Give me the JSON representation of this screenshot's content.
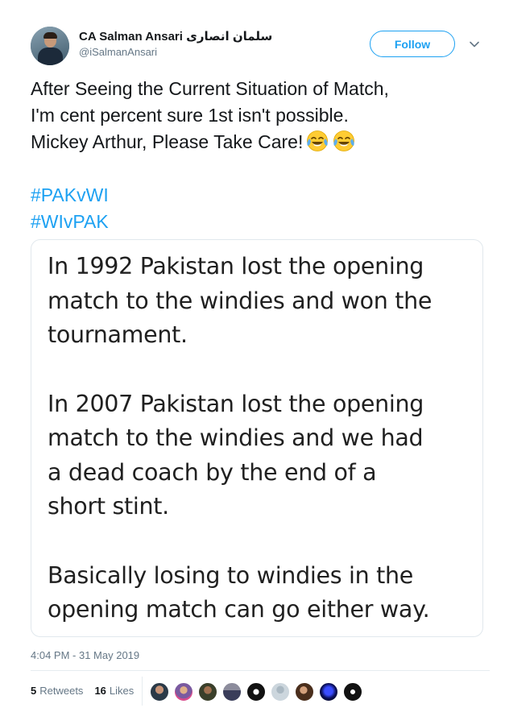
{
  "user": {
    "display_name": "CA Salman Ansari سلمان انصاری",
    "screen_name": "@iSalmanAnsari",
    "avatar_icon": "profile-photo"
  },
  "follow_label": "Follow",
  "tweet": {
    "lines": [
      "After Seeing the Current Situation of Match,",
      "I'm cent percent sure 1st isn't possible.",
      "Mickey Arthur, Please Take Care!"
    ],
    "emoji": "face-with-tears-of-joy-icon",
    "hashtags": [
      "#PAKvWI",
      "#WIvPAK"
    ]
  },
  "media_text": {
    "paragraphs": [
      [
        "In 1992 Pakistan lost the opening",
        "match to the windies and won the",
        "tournament."
      ],
      [
        "In 2007 Pakistan lost the opening",
        "match to the windies and we had",
        "a dead coach by the end of a",
        "short stint."
      ],
      [
        "Basically losing to windies in the",
        "opening match can go either way."
      ]
    ]
  },
  "timestamp": "4:04 PM - 31 May 2019",
  "stats": {
    "retweets_count": "5",
    "retweets_label": "Retweets",
    "likes_count": "16",
    "likes_label": "Likes"
  },
  "colors": {
    "accent": "#1da1f2",
    "secondary_text": "#657786",
    "border": "#e1e8ed"
  }
}
